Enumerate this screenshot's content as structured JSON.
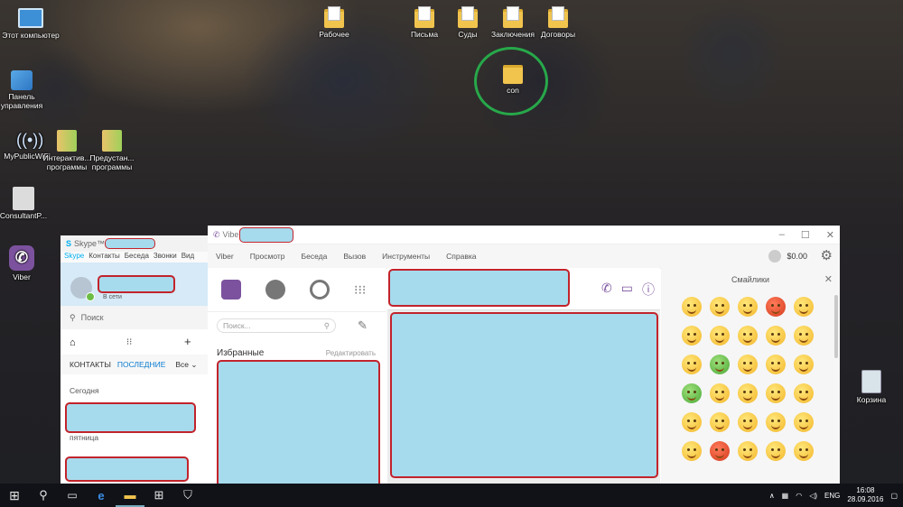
{
  "desktop": {
    "icons": [
      {
        "label": "Этот компьютер"
      },
      {
        "label": "Панель управления"
      },
      {
        "label": "MyPublicWiFi"
      },
      {
        "label": "Интерактив... программы"
      },
      {
        "label": "Предустан... программы"
      },
      {
        "label": "ConsultantP..."
      },
      {
        "label": "Viber"
      },
      {
        "label": "Рабочее"
      },
      {
        "label": "Письма"
      },
      {
        "label": "Суды"
      },
      {
        "label": "Заключения"
      },
      {
        "label": "Договоры"
      },
      {
        "label": "con"
      },
      {
        "label": "Корзина"
      }
    ]
  },
  "skype": {
    "title": "Skype™",
    "menu": [
      "Skype",
      "Контакты",
      "Беседа",
      "Звонки",
      "Вид"
    ],
    "status": "В сети",
    "search_placeholder": "Поиск",
    "tabs": {
      "contacts": "КОНТАКТЫ",
      "recent": "ПОСЛЕДНИЕ",
      "all": "Все"
    },
    "sections": {
      "today": "Сегодня",
      "friday": "пятница"
    }
  },
  "viber": {
    "title": "Viber",
    "menu": [
      "Viber",
      "Просмотр",
      "Беседа",
      "Вызов",
      "Инструменты",
      "Справка"
    ],
    "balance": "$0.00",
    "search_placeholder": "Поиск...",
    "favorites_label": "Избранные",
    "edit_label": "Редактировать",
    "emoji_panel_title": "Смайлики"
  },
  "taskbar": {
    "lang": "ENG",
    "time": "16:08",
    "date": "28.09.2016"
  }
}
